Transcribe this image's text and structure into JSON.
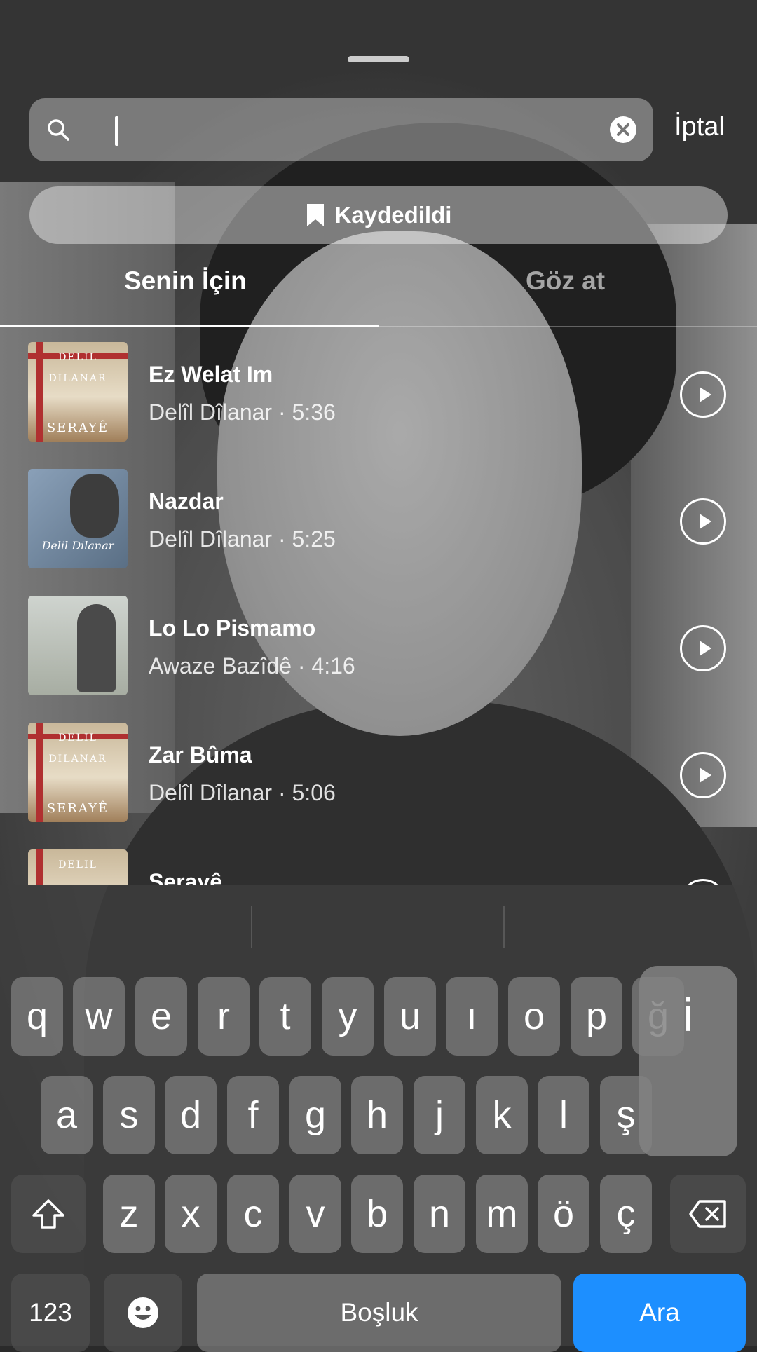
{
  "search": {
    "value": "",
    "placeholder": "",
    "cancel_label": "İptal"
  },
  "saved_button": {
    "label": "Kaydedildi"
  },
  "tabs": [
    {
      "label": "Senin İçin",
      "active": true
    },
    {
      "label": "Göz at",
      "active": false
    }
  ],
  "tracks": [
    {
      "title": "Ez Welat Im",
      "artist": "Delîl Dîlanar",
      "duration": "5:36",
      "meta": "Delîl Dîlanar · 5:36",
      "cover_text": [
        "DELIL",
        "DILANAR",
        "SERAYÊ"
      ]
    },
    {
      "title": "Nazdar",
      "artist": "Delîl Dîlanar",
      "duration": "5:25",
      "meta": "Delîl Dîlanar · 5:25",
      "cover_text": [
        "Delil Dilanar"
      ]
    },
    {
      "title": "Lo Lo Pismamo",
      "artist": "Awaze Bazîdê",
      "duration": "4:16",
      "meta": "Awaze Bazîdê · 4:16",
      "cover_text": []
    },
    {
      "title": "Zar Bûma",
      "artist": "Delîl Dîlanar",
      "duration": "5:06",
      "meta": "Delîl Dîlanar · 5:06",
      "cover_text": [
        "DELIL",
        "DILANAR",
        "SERAYÊ"
      ]
    },
    {
      "title": "Serayê",
      "artist": "",
      "duration": "",
      "meta": "",
      "cover_text": [
        "DELIL"
      ]
    }
  ],
  "keyboard": {
    "row1": [
      "q",
      "w",
      "e",
      "r",
      "t",
      "y",
      "u",
      "ı",
      "o",
      "p",
      "ğ"
    ],
    "row2": [
      "a",
      "s",
      "d",
      "f",
      "g",
      "h",
      "j",
      "k",
      "l",
      "ş",
      "i"
    ],
    "row3": [
      "z",
      "x",
      "c",
      "v",
      "b",
      "n",
      "m",
      "ö",
      "ç"
    ],
    "popup_key": "i",
    "num_label": "123",
    "space_label": "Boşluk",
    "return_label": "Ara"
  },
  "colors": {
    "accent": "#1d8fff"
  }
}
